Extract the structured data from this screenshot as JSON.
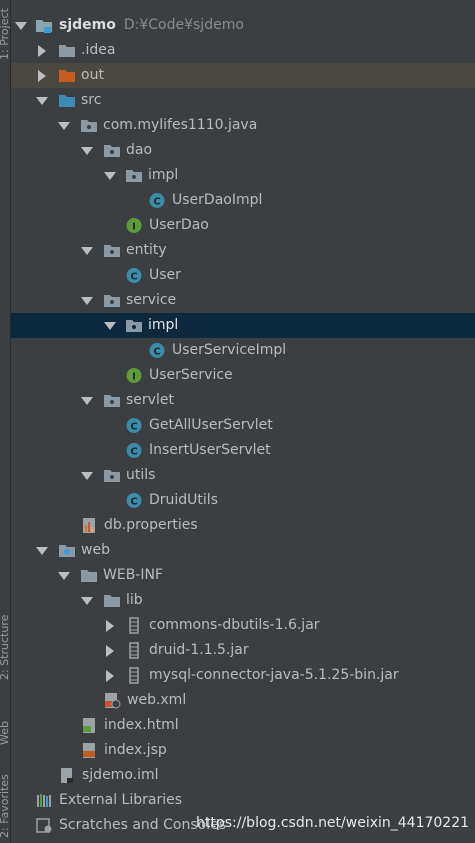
{
  "side_tabs": {
    "project": "1: Project",
    "structure": "2: Structure",
    "web": "Web",
    "favorites": "2: Favorites"
  },
  "watermark": "https://blog.csdn.net/weixin_44170221",
  "tree": [
    {
      "id": "sjdemo",
      "label": "sjdemo",
      "path": "D:¥Code¥sjdemo",
      "icon": "module-folder-icon",
      "expanded": true
    },
    {
      "id": "idea",
      "label": ".idea",
      "icon": "folder-icon",
      "expanded": false
    },
    {
      "id": "out",
      "label": "out",
      "icon": "excluded-folder-icon",
      "expanded": false
    },
    {
      "id": "src",
      "label": "src",
      "icon": "source-folder-icon",
      "expanded": true
    },
    {
      "id": "pkg-root",
      "label": "com.mylifes1110.java",
      "icon": "package-icon",
      "expanded": true
    },
    {
      "id": "dao",
      "label": "dao",
      "icon": "package-icon",
      "expanded": true
    },
    {
      "id": "dao-impl",
      "label": "impl",
      "icon": "package-icon",
      "expanded": true
    },
    {
      "id": "UserDaoImpl",
      "label": "UserDaoImpl",
      "icon": "class-icon"
    },
    {
      "id": "UserDao",
      "label": "UserDao",
      "icon": "interface-icon"
    },
    {
      "id": "entity",
      "label": "entity",
      "icon": "package-icon",
      "expanded": true
    },
    {
      "id": "User",
      "label": "User",
      "icon": "class-icon"
    },
    {
      "id": "service",
      "label": "service",
      "icon": "package-icon",
      "expanded": true
    },
    {
      "id": "service-impl",
      "label": "impl",
      "icon": "package-icon",
      "expanded": true
    },
    {
      "id": "UserServiceImpl",
      "label": "UserServiceImpl",
      "icon": "class-icon"
    },
    {
      "id": "UserService",
      "label": "UserService",
      "icon": "interface-icon"
    },
    {
      "id": "servlet",
      "label": "servlet",
      "icon": "package-icon",
      "expanded": true
    },
    {
      "id": "GetAllUserServlet",
      "label": "GetAllUserServlet",
      "icon": "class-icon"
    },
    {
      "id": "InsertUserServlet",
      "label": "InsertUserServlet",
      "icon": "class-icon"
    },
    {
      "id": "utils",
      "label": "utils",
      "icon": "package-icon",
      "expanded": true
    },
    {
      "id": "DruidUtils",
      "label": "DruidUtils",
      "icon": "class-icon"
    },
    {
      "id": "db-properties",
      "label": "db.properties",
      "icon": "properties-file-icon"
    },
    {
      "id": "web",
      "label": "web",
      "icon": "web-folder-icon",
      "expanded": true
    },
    {
      "id": "web-inf",
      "label": "WEB-INF",
      "icon": "folder-icon",
      "expanded": true
    },
    {
      "id": "lib",
      "label": "lib",
      "icon": "folder-icon",
      "expanded": true
    },
    {
      "id": "dbutils-jar",
      "label": "commons-dbutils-1.6.jar",
      "icon": "jar-icon",
      "expanded": false
    },
    {
      "id": "druid-jar",
      "label": "druid-1.1.5.jar",
      "icon": "jar-icon",
      "expanded": false
    },
    {
      "id": "mysql-jar",
      "label": "mysql-connector-java-5.1.25-bin.jar",
      "icon": "jar-icon",
      "expanded": false
    },
    {
      "id": "web-xml",
      "label": "web.xml",
      "icon": "xml-file-icon"
    },
    {
      "id": "index-html",
      "label": "index.html",
      "icon": "html-file-icon"
    },
    {
      "id": "index-jsp",
      "label": "index.jsp",
      "icon": "jsp-file-icon"
    },
    {
      "id": "sjdemo-iml",
      "label": "sjdemo.iml",
      "icon": "iml-file-icon"
    },
    {
      "id": "ext-libs",
      "label": "External Libraries",
      "icon": "libraries-icon",
      "expanded": false
    },
    {
      "id": "scratches",
      "label": "Scratches and Consoles",
      "icon": "scratches-icon",
      "expanded": false
    }
  ]
}
